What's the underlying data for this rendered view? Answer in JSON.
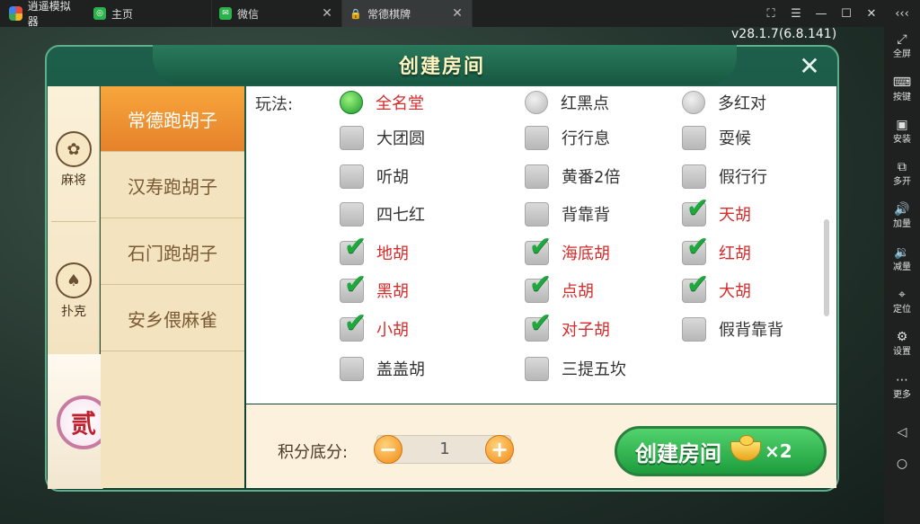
{
  "titlebar": {
    "app_name": "逍遥模拟器",
    "tabs": [
      {
        "label": "主页",
        "closable": false
      },
      {
        "label": "微信",
        "closable": true
      },
      {
        "label": "常德棋牌",
        "closable": true,
        "active": true
      }
    ],
    "controls": {
      "resize": "⛶",
      "menu": "☰",
      "minimize": "—",
      "maximize": "☐",
      "close": "✕",
      "collapse": "‹‹‹"
    }
  },
  "sidebar": {
    "items": [
      {
        "icon": "fullscreen-icon",
        "glyph": "⤢",
        "label": "全屏"
      },
      {
        "icon": "keyboard-icon",
        "glyph": "⌨",
        "label": "按键"
      },
      {
        "icon": "apk-icon",
        "glyph": "▣",
        "label": "安装"
      },
      {
        "icon": "multi-instance-icon",
        "glyph": "⧉",
        "label": "多开"
      },
      {
        "icon": "volume-up-icon",
        "glyph": "🔊",
        "label": "加量"
      },
      {
        "icon": "volume-down-icon",
        "glyph": "🔉",
        "label": "减量"
      },
      {
        "icon": "location-icon",
        "glyph": "⌖",
        "label": "定位"
      },
      {
        "icon": "settings-icon",
        "glyph": "⚙",
        "label": "设置"
      },
      {
        "icon": "more-icon",
        "glyph": "⋯",
        "label": "更多"
      },
      {
        "icon": "back-icon",
        "glyph": "◁",
        "label": ""
      },
      {
        "icon": "home-icon",
        "glyph": "○",
        "label": ""
      }
    ]
  },
  "game": {
    "version": "v28.1.7(6.8.141)",
    "dialog": {
      "title": "创建房间",
      "close_glyph": "✕",
      "categories": [
        {
          "label": "麻将",
          "emblem": "✿"
        },
        {
          "label": "扑克",
          "emblem": "♠"
        }
      ],
      "level_badge": "贰",
      "games": [
        {
          "label": "常德跑胡子",
          "active": true
        },
        {
          "label": "汉寿跑胡子",
          "active": false
        },
        {
          "label": "石门跑胡子",
          "active": false
        },
        {
          "label": "安乡偎麻雀",
          "active": false
        }
      ],
      "rules_label": "玩法:",
      "play_modes": [
        {
          "label": "全名堂",
          "selected": true
        },
        {
          "label": "红黑点",
          "selected": false
        },
        {
          "label": "多红对",
          "selected": false
        }
      ],
      "options": [
        {
          "label": "大团圆",
          "checked": false
        },
        {
          "label": "行行息",
          "checked": false
        },
        {
          "label": "耍候",
          "checked": false
        },
        {
          "label": "听胡",
          "checked": false
        },
        {
          "label": "黄番2倍",
          "checked": false
        },
        {
          "label": "假行行",
          "checked": false
        },
        {
          "label": "四七红",
          "checked": false
        },
        {
          "label": "背靠背",
          "checked": false
        },
        {
          "label": "天胡",
          "checked": true
        },
        {
          "label": "地胡",
          "checked": true
        },
        {
          "label": "海底胡",
          "checked": true
        },
        {
          "label": "红胡",
          "checked": true
        },
        {
          "label": "黑胡",
          "checked": true
        },
        {
          "label": "点胡",
          "checked": true
        },
        {
          "label": "大胡",
          "checked": true
        },
        {
          "label": "小胡",
          "checked": true
        },
        {
          "label": "对子胡",
          "checked": true
        },
        {
          "label": "假背靠背",
          "checked": false
        },
        {
          "label": "盖盖胡",
          "checked": false
        },
        {
          "label": "三提五坎",
          "checked": false
        }
      ],
      "score": {
        "label": "积分底分:",
        "value": "1",
        "minus": "−",
        "plus": "+"
      },
      "create_button": {
        "label": "创建房间",
        "cost": "×2"
      }
    }
  },
  "colors": {
    "accent_green": "#1d9c3c",
    "active_tab": "#e5822b",
    "checked_text": "#d52c2c"
  }
}
